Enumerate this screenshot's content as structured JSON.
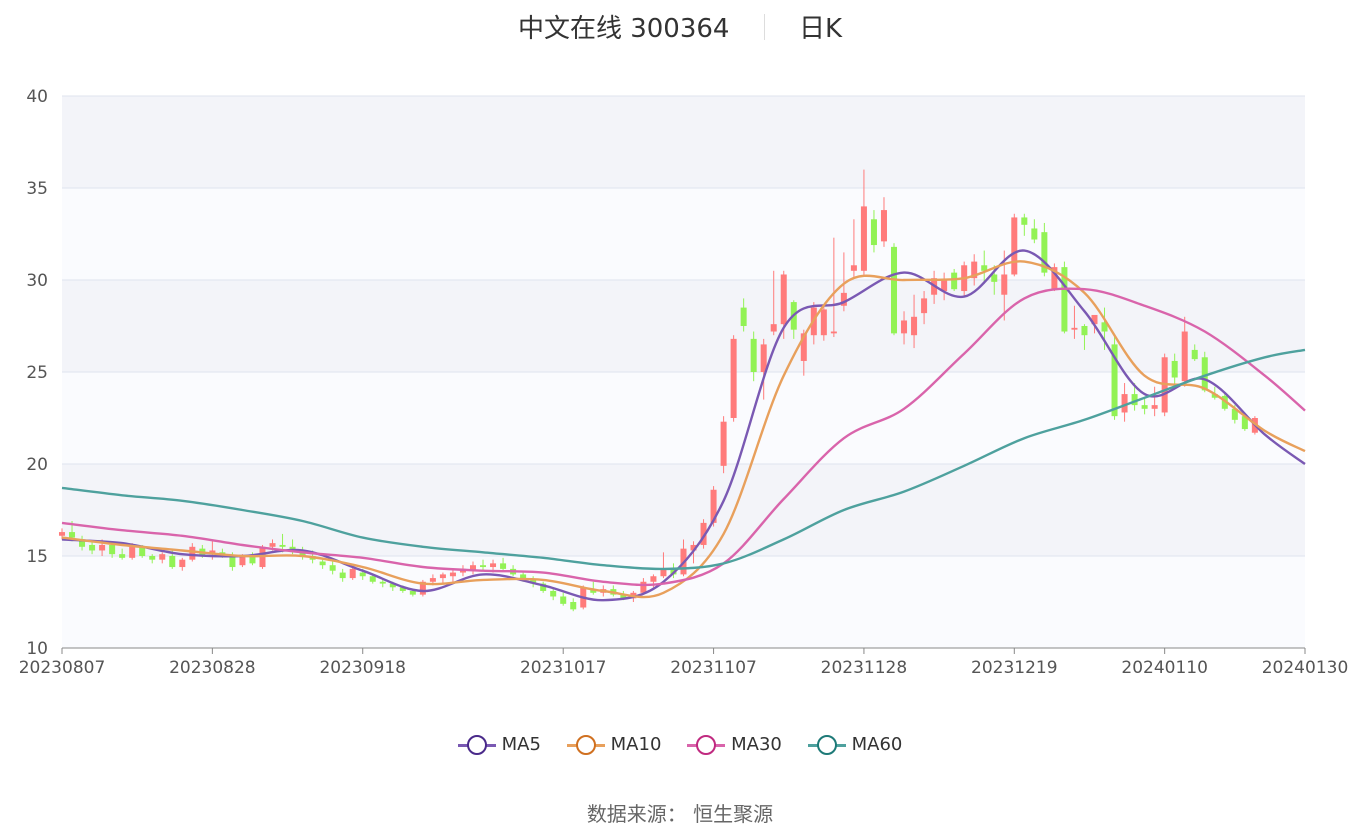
{
  "header": {
    "title": "中文在线 300364",
    "period": "日K"
  },
  "footer": {
    "source": "数据来源： 恒生聚源"
  },
  "chart_data": {
    "type": "candlestick",
    "title": "中文在线 300364",
    "ylim": [
      10,
      40
    ],
    "y_ticks": [
      "10",
      "15",
      "20",
      "25",
      "30",
      "35",
      "40"
    ],
    "x_tick_labels": [
      "20230807",
      "20230828",
      "20230918",
      "20231017",
      "20231107",
      "20231128",
      "20231219",
      "20240110",
      "20240130"
    ],
    "x_tick_index": [
      0,
      15,
      30,
      50,
      65,
      80,
      95,
      110,
      124
    ],
    "n_days": 125,
    "colors": {
      "up": "#ff7b7b",
      "down": "#92f255"
    },
    "ohlc_columns": [
      "open",
      "high",
      "low",
      "close"
    ],
    "ohlc": [
      [
        16.1,
        16.5,
        15.9,
        16.3
      ],
      [
        16.3,
        16.9,
        15.8,
        16.0
      ],
      [
        15.9,
        16.1,
        15.3,
        15.5
      ],
      [
        15.6,
        15.8,
        15.1,
        15.3
      ],
      [
        15.3,
        15.9,
        15.0,
        15.6
      ],
      [
        15.6,
        15.8,
        14.9,
        15.1
      ],
      [
        15.1,
        15.4,
        14.8,
        14.9
      ],
      [
        14.9,
        15.7,
        14.8,
        15.5
      ],
      [
        15.5,
        15.6,
        14.9,
        15.0
      ],
      [
        15.0,
        15.1,
        14.6,
        14.8
      ],
      [
        14.8,
        15.2,
        14.6,
        15.1
      ],
      [
        15.0,
        15.3,
        14.3,
        14.4
      ],
      [
        14.4,
        14.9,
        14.2,
        14.8
      ],
      [
        14.8,
        15.7,
        14.7,
        15.5
      ],
      [
        15.4,
        15.6,
        14.9,
        15.0
      ],
      [
        15.1,
        15.8,
        14.8,
        15.3
      ],
      [
        15.2,
        15.4,
        14.9,
        15.0
      ],
      [
        15.0,
        15.2,
        14.2,
        14.4
      ],
      [
        14.5,
        15.1,
        14.4,
        15.0
      ],
      [
        15.0,
        15.2,
        14.5,
        14.6
      ],
      [
        14.4,
        15.6,
        14.3,
        15.5
      ],
      [
        15.5,
        15.9,
        15.3,
        15.7
      ],
      [
        15.6,
        16.2,
        15.2,
        15.5
      ],
      [
        15.5,
        15.9,
        15.1,
        15.3
      ],
      [
        15.3,
        15.5,
        14.8,
        15.0
      ],
      [
        15.0,
        15.3,
        14.6,
        14.8
      ],
      [
        14.7,
        14.8,
        14.3,
        14.5
      ],
      [
        14.5,
        14.7,
        14.0,
        14.2
      ],
      [
        14.1,
        14.3,
        13.6,
        13.8
      ],
      [
        13.8,
        14.4,
        13.7,
        14.3
      ],
      [
        14.1,
        14.3,
        13.7,
        13.9
      ],
      [
        13.9,
        14.0,
        13.5,
        13.6
      ],
      [
        13.6,
        13.8,
        13.3,
        13.5
      ],
      [
        13.5,
        13.6,
        13.1,
        13.3
      ],
      [
        13.3,
        13.4,
        13.0,
        13.1
      ],
      [
        13.1,
        13.2,
        12.8,
        12.9
      ],
      [
        12.9,
        13.7,
        12.8,
        13.6
      ],
      [
        13.6,
        14.0,
        13.4,
        13.8
      ],
      [
        13.8,
        14.1,
        13.5,
        14.0
      ],
      [
        13.9,
        14.3,
        13.6,
        14.1
      ],
      [
        14.1,
        14.5,
        13.9,
        14.3
      ],
      [
        14.2,
        14.7,
        14.0,
        14.5
      ],
      [
        14.5,
        14.8,
        14.2,
        14.4
      ],
      [
        14.4,
        14.8,
        14.1,
        14.6
      ],
      [
        14.6,
        14.9,
        14.2,
        14.3
      ],
      [
        14.3,
        14.5,
        13.9,
        14.0
      ],
      [
        14.0,
        14.2,
        13.6,
        13.8
      ],
      [
        13.7,
        13.9,
        13.3,
        13.5
      ],
      [
        13.5,
        13.6,
        13.0,
        13.1
      ],
      [
        13.1,
        13.3,
        12.6,
        12.8
      ],
      [
        12.8,
        13.0,
        12.3,
        12.4
      ],
      [
        12.5,
        12.7,
        12.0,
        12.1
      ],
      [
        12.2,
        13.4,
        12.1,
        13.3
      ],
      [
        13.2,
        13.6,
        12.9,
        13.0
      ],
      [
        13.0,
        13.4,
        12.8,
        13.2
      ],
      [
        13.2,
        13.4,
        12.8,
        12.9
      ],
      [
        12.9,
        13.1,
        12.6,
        12.7
      ],
      [
        12.7,
        13.1,
        12.5,
        13.0
      ],
      [
        13.0,
        13.8,
        12.9,
        13.6
      ],
      [
        13.6,
        14.0,
        13.3,
        13.9
      ],
      [
        13.9,
        15.2,
        13.8,
        14.3
      ],
      [
        14.3,
        14.6,
        13.8,
        14.0
      ],
      [
        14.0,
        15.9,
        13.9,
        15.4
      ],
      [
        15.3,
        15.8,
        14.6,
        15.6
      ],
      [
        15.6,
        17.0,
        15.4,
        16.8
      ],
      [
        16.8,
        18.8,
        16.6,
        18.6
      ],
      [
        19.9,
        22.6,
        19.5,
        22.3
      ],
      [
        22.5,
        27.0,
        22.3,
        26.8
      ],
      [
        28.5,
        29.0,
        27.2,
        27.5
      ],
      [
        26.8,
        27.2,
        24.5,
        25.0
      ],
      [
        25.0,
        26.8,
        23.5,
        26.5
      ],
      [
        27.2,
        30.5,
        27.0,
        27.6
      ],
      [
        27.6,
        30.5,
        26.8,
        30.3
      ],
      [
        28.8,
        28.9,
        26.8,
        27.3
      ],
      [
        25.6,
        27.3,
        24.8,
        27.1
      ],
      [
        27.0,
        28.8,
        26.5,
        28.5
      ],
      [
        27.0,
        28.6,
        26.7,
        28.4
      ],
      [
        27.1,
        32.3,
        26.9,
        27.2
      ],
      [
        28.6,
        31.5,
        28.3,
        29.3
      ],
      [
        30.5,
        33.3,
        30.1,
        30.8
      ],
      [
        30.5,
        36.0,
        30.2,
        34.0
      ],
      [
        33.3,
        33.8,
        31.5,
        31.9
      ],
      [
        32.1,
        34.5,
        31.8,
        33.8
      ],
      [
        31.8,
        32.0,
        27.0,
        27.1
      ],
      [
        27.1,
        28.3,
        26.5,
        27.8
      ],
      [
        27.0,
        29.2,
        26.3,
        28.0
      ],
      [
        28.2,
        29.4,
        27.6,
        29.0
      ],
      [
        29.2,
        30.5,
        28.7,
        30.1
      ],
      [
        29.4,
        30.4,
        28.9,
        30.0
      ],
      [
        30.4,
        30.6,
        29.4,
        29.5
      ],
      [
        29.4,
        31.0,
        29.1,
        30.8
      ],
      [
        30.1,
        31.4,
        29.7,
        31.0
      ],
      [
        30.8,
        31.6,
        29.8,
        30.5
      ],
      [
        30.3,
        30.8,
        29.2,
        29.9
      ],
      [
        29.2,
        31.6,
        27.8,
        30.3
      ],
      [
        30.3,
        33.6,
        30.2,
        33.4
      ],
      [
        33.4,
        33.6,
        32.4,
        33.0
      ],
      [
        32.8,
        33.3,
        32.0,
        32.2
      ],
      [
        32.6,
        33.1,
        30.2,
        30.4
      ],
      [
        29.5,
        30.9,
        29.4,
        30.7
      ],
      [
        30.7,
        31.0,
        27.1,
        27.2
      ],
      [
        27.3,
        28.6,
        26.8,
        27.4
      ],
      [
        27.5,
        27.6,
        26.2,
        27.0
      ],
      [
        27.6,
        28.0,
        27.1,
        28.1
      ],
      [
        27.7,
        28.5,
        26.2,
        27.2
      ],
      [
        26.5,
        27.0,
        22.4,
        22.6
      ],
      [
        22.8,
        24.4,
        22.3,
        23.8
      ],
      [
        23.8,
        24.4,
        22.9,
        23.2
      ],
      [
        23.2,
        23.6,
        22.7,
        23.0
      ],
      [
        23.0,
        24.2,
        22.6,
        23.2
      ],
      [
        22.8,
        26.0,
        22.6,
        25.8
      ],
      [
        25.6,
        26.0,
        24.2,
        24.7
      ],
      [
        24.5,
        28.0,
        24.2,
        27.2
      ],
      [
        26.2,
        26.5,
        25.6,
        25.7
      ],
      [
        25.8,
        26.1,
        23.9,
        24.0
      ],
      [
        23.8,
        24.2,
        23.5,
        23.6
      ],
      [
        23.7,
        23.8,
        22.9,
        23.0
      ],
      [
        23.0,
        23.2,
        22.2,
        22.4
      ],
      [
        22.6,
        22.8,
        21.8,
        21.9
      ],
      [
        21.7,
        22.6,
        21.6,
        22.5
      ]
    ],
    "series": [
      {
        "name": "MA5",
        "color": "#7a59b3",
        "legend_color": "#4a2a8a"
      },
      {
        "name": "MA10",
        "color": "#e8a05c",
        "legend_color": "#d07020"
      },
      {
        "name": "MA30",
        "color": "#d964ab",
        "legend_color": "#c02a80"
      },
      {
        "name": "MA60",
        "color": "#4ea19e",
        "legend_color": "#1e7a78"
      }
    ],
    "ma_x_index": [
      0,
      6,
      12,
      18,
      24,
      30,
      36,
      42,
      48,
      54,
      60,
      66,
      72,
      78,
      84,
      90,
      96,
      102,
      108,
      114,
      120,
      124
    ],
    "ma_values": {
      "MA5": [
        15.9,
        15.7,
        15.1,
        15.0,
        15.3,
        14.2,
        13.1,
        14.0,
        13.4,
        12.6,
        13.6,
        18.0,
        27.4,
        28.8,
        30.4,
        29.1,
        31.6,
        28.3,
        23.8,
        24.6,
        21.6,
        20.0
      ],
      "MA10": [
        16.0,
        15.6,
        15.3,
        15.0,
        15.0,
        14.4,
        13.5,
        13.7,
        13.7,
        13.1,
        13.0,
        16.2,
        24.8,
        29.8,
        30.0,
        30.1,
        31.0,
        29.3,
        24.8,
        24.1,
        21.8,
        20.7
      ],
      "MA30": [
        16.8,
        16.4,
        16.1,
        15.6,
        15.2,
        14.9,
        14.4,
        14.2,
        14.1,
        13.6,
        13.5,
        14.6,
        18.1,
        21.4,
        23.0,
        26.0,
        29.0,
        29.5,
        28.6,
        27.2,
        24.8,
        22.9
      ],
      "MA60": [
        18.7,
        18.3,
        18.0,
        17.5,
        16.9,
        16.0,
        15.5,
        15.2,
        14.9,
        14.5,
        14.3,
        14.6,
        15.9,
        17.5,
        18.5,
        19.9,
        21.4,
        22.4,
        23.6,
        24.8,
        25.8,
        26.2
      ]
    }
  }
}
